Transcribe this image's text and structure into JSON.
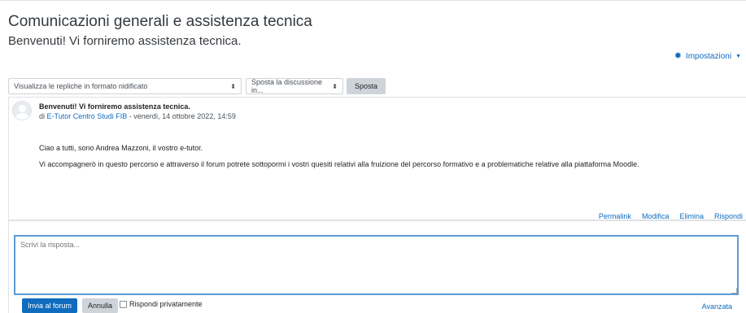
{
  "page": {
    "title": "Comunicazioni generali e assistenza tecnica",
    "subtitle": "Benvenuti! Vi forniremo assistenza tecnica."
  },
  "settings": {
    "label": "Impostazioni",
    "icon": "gear-icon"
  },
  "controls": {
    "display_mode": "Visualizza le repliche in formato nidificato",
    "move_select": "Sposta la discussione in...",
    "move_button": "Sposta"
  },
  "post": {
    "subject": "Benvenuti! Vi forniremo assistenza tecnica.",
    "by": "di",
    "author": "E-Tutor Centro Studi FIB",
    "date": "- venerdì, 14 ottobre 2022, 14:59",
    "paragraphs": [
      "Ciao a tutti, sono Andrea Mazzoni, il vostro e-tutor.",
      "Vi accompagnerò in questo percorso e attraverso il forum potrete sottopormi i vostri quesiti relativi alla fruizione del percorso formativo e a problematiche relative alla piattaforma Moodle."
    ],
    "actions": {
      "permalink": "Permalink",
      "edit": "Modifica",
      "delete": "Elimina",
      "reply": "Rispondi"
    }
  },
  "reply": {
    "placeholder": "Scrivi la risposta...",
    "submit": "Invia al forum",
    "cancel": "Annulla",
    "private": "Rispondi privatamente",
    "advanced": "Avanzata"
  },
  "colors": {
    "link": "#0f6cbf",
    "primary": "#0f6cbf",
    "focus_border": "#5b9bd5"
  }
}
